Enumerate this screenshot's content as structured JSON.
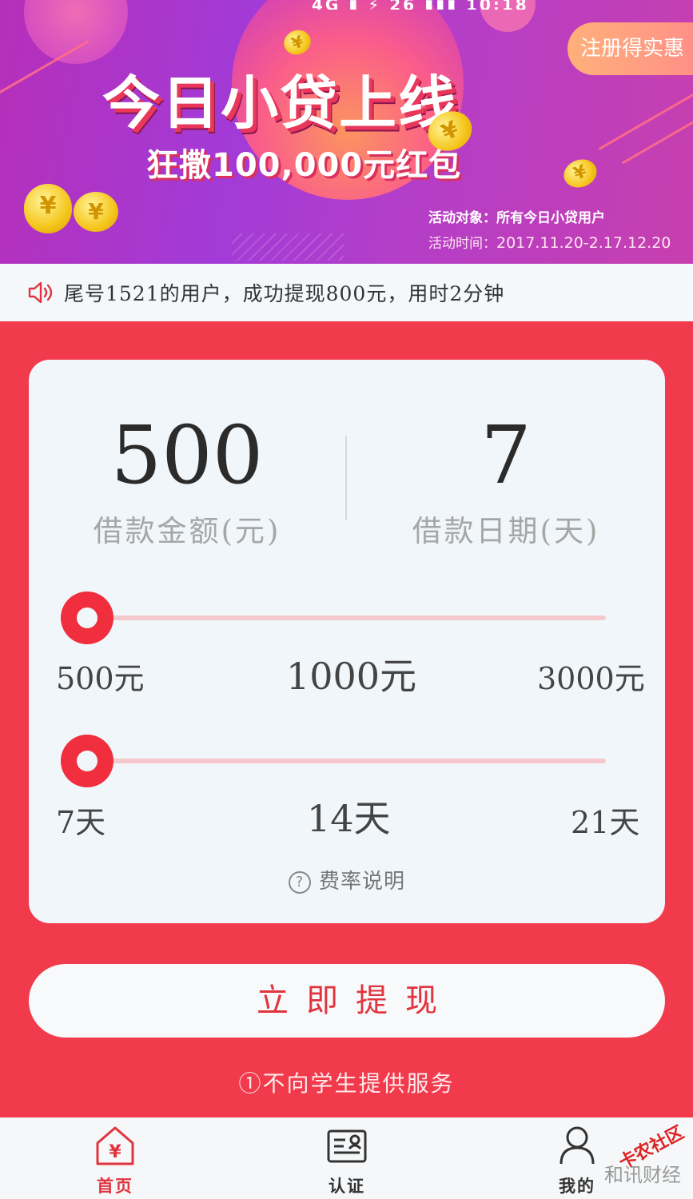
{
  "banner": {
    "status_text": "4G ▮ ⚡ 26 ▮▮▮ 10:18",
    "title": "今日小贷上线",
    "subtitle": "狂撒100,000元红包",
    "register_badge": "注册得实惠",
    "audience_label": "活动对象：",
    "audience_value": "所有今日小贷用户",
    "period_label": "活动时间：",
    "period_value": "2017.11.20-2.17.12.20",
    "coin_symbol": "¥"
  },
  "notice": {
    "icon": "speaker-icon",
    "text": "尾号1521的用户，成功提现800元，用时2分钟"
  },
  "loan": {
    "amount_value": "500",
    "amount_label": "借款金额(元)",
    "days_value": "7",
    "days_label": "借款日期(天)",
    "amount_slider": {
      "level": 0.0,
      "ticks": [
        "500元",
        "1000元",
        "3000元"
      ]
    },
    "days_slider": {
      "level": 0.0,
      "ticks": [
        "7天",
        "14天",
        "21天"
      ]
    },
    "fee_icon": "?",
    "fee_link": "费率说明"
  },
  "withdraw_button": "立即提现",
  "student_notice": "①不向学生提供服务",
  "tabbar": {
    "items": [
      {
        "label": "首页",
        "icon": "home-yen-icon",
        "active": true
      },
      {
        "label": "认证",
        "icon": "id-card-icon",
        "active": false
      },
      {
        "label": "我的",
        "icon": "user-icon",
        "active": false
      }
    ]
  },
  "watermark": {
    "logo": "卡农社区",
    "source": "和讯财经"
  },
  "colors": {
    "primary_red": "#f02e3e",
    "page_bg": "#f13a4c",
    "card_bg": "#f1f6fa",
    "banner_purple": "#a23bd7"
  }
}
